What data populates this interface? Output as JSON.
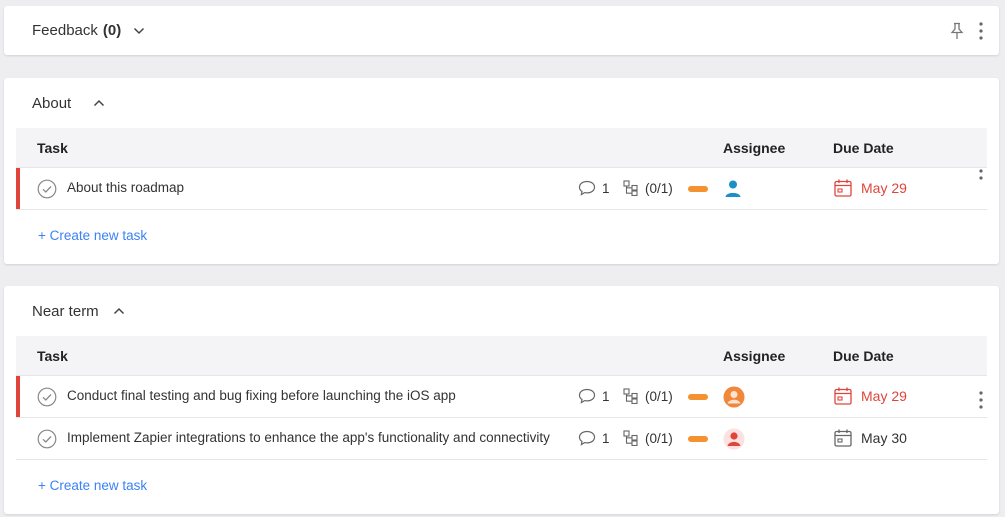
{
  "feedback": {
    "title": "Feedback",
    "count": "(0)"
  },
  "sections": [
    {
      "title": "About",
      "columns": {
        "task": "Task",
        "assignee": "Assignee",
        "due": "Due Date"
      },
      "tasks": [
        {
          "title": "About this roadmap",
          "comments": "1",
          "subtasks": "(0/1)",
          "due": "May 29"
        }
      ],
      "create_label": "+ Create new task"
    },
    {
      "title": "Near term",
      "columns": {
        "task": "Task",
        "assignee": "Assignee",
        "due": "Due Date"
      },
      "tasks": [
        {
          "title": "Conduct final testing and bug fixing before launching the iOS app",
          "comments": "1",
          "subtasks": "(0/1)",
          "due": "May 29"
        },
        {
          "title": "Implement Zapier integrations to enhance the app's functionality and connectivity",
          "comments": "1",
          "subtasks": "(0/1)",
          "due": "May 30"
        }
      ],
      "create_label": "+ Create new task"
    }
  ],
  "colors": {
    "overdue": "#e0453b",
    "priority": "#f4922f",
    "link": "#3b82f6",
    "avatar_blue": "#1e8fc6",
    "avatar_orange": "#f0873a",
    "avatar_red": "#e0453b"
  },
  "icons": [
    "chevron-down-icon",
    "chevron-up-icon",
    "pin-icon",
    "more-vertical-icon",
    "check-circle-icon",
    "comment-icon",
    "subtask-icon",
    "calendar-icon",
    "avatar-icon"
  ]
}
